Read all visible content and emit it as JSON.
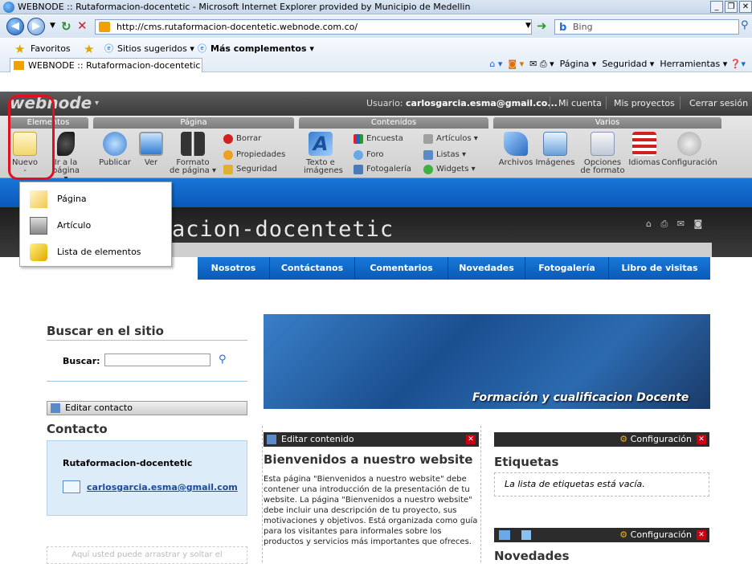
{
  "window": {
    "title": "WEBNODE :: Rutaformacion-docentetic - Microsoft Internet Explorer provided by Municipio de Medellin"
  },
  "address": {
    "url": "http://cms.rutaformacion-docentetic.webnode.com.co/",
    "search_placeholder": "Bing"
  },
  "favorites": {
    "favoritos": "Favoritos",
    "sugeridos": "Sitios sugeridos ▾",
    "complementos": "Más complementos ▾"
  },
  "tab": {
    "label": "WEBNODE :: Rutaformacion-docentetic"
  },
  "commandbar": {
    "pagina": "Página ▾",
    "seguridad": "Seguridad ▾",
    "herramientas": "Herramientas ▾"
  },
  "webnode": {
    "logo": "webnode",
    "user_label": "Usuario: ",
    "user_email": "carlosgarcia.esma@gmail.co...",
    "mi_cuenta": "Mi cuenta",
    "mis_proyectos": "Mis proyectos",
    "cerrar": "Cerrar sesión"
  },
  "ribbon": {
    "groups": {
      "elementos": "Elementos",
      "pagina": "Página",
      "contenidos": "Contenidos",
      "varios": "Varios"
    },
    "nuevo": "Nuevo",
    "ir_a_la": "Ir a la",
    "pagina_dd": "página ▾",
    "publicar": "Publicar",
    "ver": "Ver",
    "formato": "Formato",
    "de_pagina": "de página ▾",
    "borrar": "Borrar",
    "propiedades": "Propiedades",
    "seguridad": "Seguridad",
    "texto_e": "Texto e",
    "imagenes": "imágenes",
    "encuesta": "Encuesta",
    "foro": "Foro",
    "fotogaleria": "Fotogalería",
    "articulos": "Artículos ▾",
    "listas": "Listas ▾",
    "widgets": "Widgets ▾",
    "archivos": "Archivos",
    "imagenes2": "Imágenes",
    "opciones": "Opciones",
    "de_formato": "de formato",
    "idiomas": "Idiomas",
    "configuracion": "Configuración"
  },
  "dropdown": {
    "items": [
      "Página",
      "Artículo",
      "Lista de elementos"
    ]
  },
  "site": {
    "title": "acion-docentetic",
    "nav": [
      "Nosotros",
      "Contáctanos",
      "Comentarios",
      "Novedades",
      "Fotogalería",
      "Libro de visitas"
    ],
    "search_title": "Buscar en el sitio",
    "buscar_label": "Buscar:",
    "edit_contact": "Editar contacto",
    "contact_title": "Contacto",
    "contact_name": "Rutaformacion-docentetic",
    "contact_email": "carlosgarcia.esma@gmail.com",
    "dropzone": "Aquí usted puede arrastrar y soltar el",
    "hero_text": "Formación y cualificacion Docente",
    "edit_content": "Editar contenido",
    "welcome_title": "Bienvenidos a nuestro website",
    "welcome_text": "Esta página \"Bienvenidos a nuestro website\" debe contener una introducción de la presentación de tu website. La página \"Bienvenidos a nuestro website\" debe incluir una descripción de tu proyecto, sus motivaciones y objetivos. Está organizada como guía para los visitantes para informales sobre los productos y servicios más importantes que ofreces.",
    "config": "Configuración",
    "etiquetas": "Etiquetas",
    "etiquetas_empty": "La lista de etiquetas está vacía.",
    "novedades": "Novedades"
  }
}
